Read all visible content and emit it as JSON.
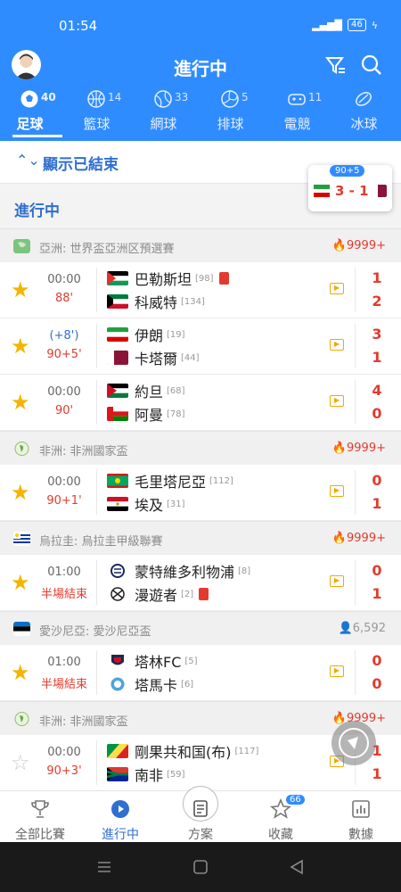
{
  "status": {
    "time": "01:54",
    "battery": "46"
  },
  "header": {
    "title": "進行中"
  },
  "tabs": [
    {
      "label": "足球",
      "count": "40",
      "icon": "soccer-ball-icon"
    },
    {
      "label": "籃球",
      "count": "14",
      "icon": "basketball-icon"
    },
    {
      "label": "網球",
      "count": "33",
      "icon": "tennis-ball-icon"
    },
    {
      "label": "排球",
      "count": "5",
      "icon": "volleyball-icon"
    },
    {
      "label": "電競",
      "count": "11",
      "icon": "gamepad-icon"
    },
    {
      "label": "冰球",
      "count": "",
      "icon": "hockey-puck-icon"
    }
  ],
  "show_finished": "顯示已結束",
  "section_title": "進行中",
  "live_card": {
    "badge": "90+5",
    "score": "3 - 1"
  },
  "groups": [
    {
      "league": "亞洲: 世界盃亞洲区預選賽",
      "heat": "9999+",
      "matches": [
        {
          "time": "00:00",
          "status": "88'",
          "home": "巴勒斯坦",
          "home_rank": "[98]",
          "away": "科威特",
          "away_rank": "[134]",
          "hs": "1",
          "as": "2"
        },
        {
          "time": "(+8')",
          "status": "90+5'",
          "home": "伊朗",
          "home_rank": "[19]",
          "away": "卡塔爾",
          "away_rank": "[44]",
          "hs": "3",
          "as": "1"
        },
        {
          "time": "00:00",
          "status": "90'",
          "home": "約旦",
          "home_rank": "[68]",
          "away": "阿曼",
          "away_rank": "[78]",
          "hs": "4",
          "as": "0"
        }
      ]
    },
    {
      "league": "非洲: 非洲國家盃",
      "heat": "9999+",
      "matches": [
        {
          "time": "00:00",
          "status": "90+1'",
          "home": "毛里塔尼亞",
          "home_rank": "[112]",
          "away": "埃及",
          "away_rank": "[31]",
          "hs": "0",
          "as": "1"
        }
      ]
    },
    {
      "league": "烏拉圭: 烏拉圭甲級聯賽",
      "heat": "9999+",
      "matches": [
        {
          "time": "01:00",
          "status": "半場結束",
          "home": "蒙特維多利物浦",
          "home_rank": "[8]",
          "away": "漫遊者",
          "away_rank": "[2]",
          "hs": "0",
          "as": "1"
        }
      ]
    },
    {
      "league": "愛沙尼亞: 愛沙尼亞盃",
      "heat": "6,592",
      "matches": [
        {
          "time": "01:00",
          "status": "半場結束",
          "home": "塔林FC",
          "home_rank": "[5]",
          "away": "塔馬卡",
          "away_rank": "[6]",
          "hs": "0",
          "as": "0"
        }
      ]
    },
    {
      "league": "非洲: 非洲國家盃",
      "heat": "9999+",
      "matches": [
        {
          "time": "00:00",
          "status": "90+3'",
          "home": "剛果共和国(布)",
          "home_rank": "[117]",
          "away": "南非",
          "away_rank": "[59]",
          "hs": "1",
          "as": "1"
        }
      ]
    }
  ],
  "bottom_nav": [
    {
      "label": "全部比賽",
      "icon": "trophy-icon"
    },
    {
      "label": "進行中",
      "icon": "play-circle-icon"
    },
    {
      "label": "方案",
      "icon": "document-icon"
    },
    {
      "label": "收藏",
      "icon": "star-icon",
      "badge": "66"
    },
    {
      "label": "數據",
      "icon": "chart-icon"
    }
  ],
  "colors": {
    "primary": "#2f8cff",
    "score_red": "#e23b2e",
    "star_gold": "#f5b400"
  }
}
